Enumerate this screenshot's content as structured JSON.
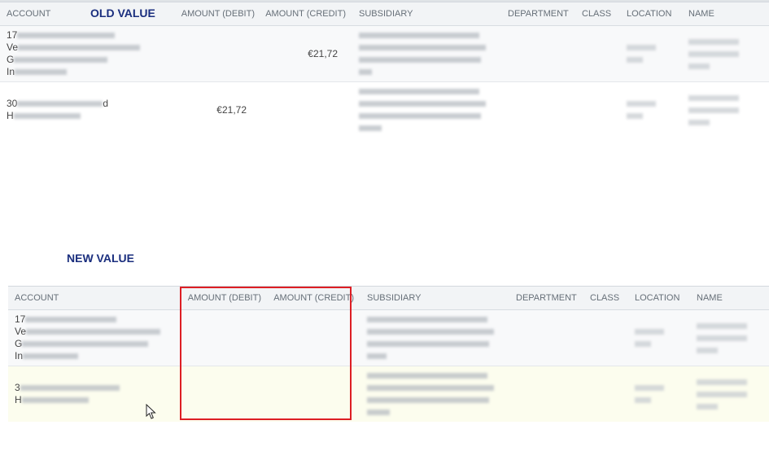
{
  "old_section": {
    "title": "OLD VALUE",
    "headers": {
      "account": "ACCOUNT",
      "debit": "AMOUNT (DEBIT)",
      "credit": "AMOUNT (CREDIT)",
      "subsidiary": "SUBSIDIARY",
      "department": "DEPARTMENT",
      "class": "CLASS",
      "location": "LOCATION",
      "name": "NAME"
    },
    "rows": [
      {
        "account_prefix": "17",
        "account_lines": [
          "",
          "Ve",
          "G",
          "In"
        ],
        "debit": "",
        "credit": "€21,72"
      },
      {
        "account_prefix": "30",
        "account_suffix": "d",
        "account_lines": [
          "",
          "H"
        ],
        "debit": "€21,72",
        "credit": ""
      }
    ]
  },
  "new_section": {
    "title": "NEW VALUE",
    "headers": {
      "account": "ACCOUNT",
      "debit": "AMOUNT (DEBIT)",
      "credit": "AMOUNT (CREDIT)",
      "subsidiary": "SUBSIDIARY",
      "department": "DEPARTMENT",
      "class": "CLASS",
      "location": "LOCATION",
      "name": "NAME"
    },
    "rows": [
      {
        "account_prefix": "17",
        "account_lines": [
          "",
          "Ve",
          "G",
          "In"
        ],
        "debit": "",
        "credit": ""
      },
      {
        "account_prefix": "3",
        "account_lines": [
          "",
          "H"
        ],
        "debit": "",
        "credit": ""
      }
    ]
  },
  "colors": {
    "section_title": "#1a2e7e",
    "highlight_border": "#dd1e24",
    "highlight_row": "#fcfdee",
    "header_bg": "#f2f4f6"
  },
  "icons": [
    "mouse-pointer-icon"
  ]
}
